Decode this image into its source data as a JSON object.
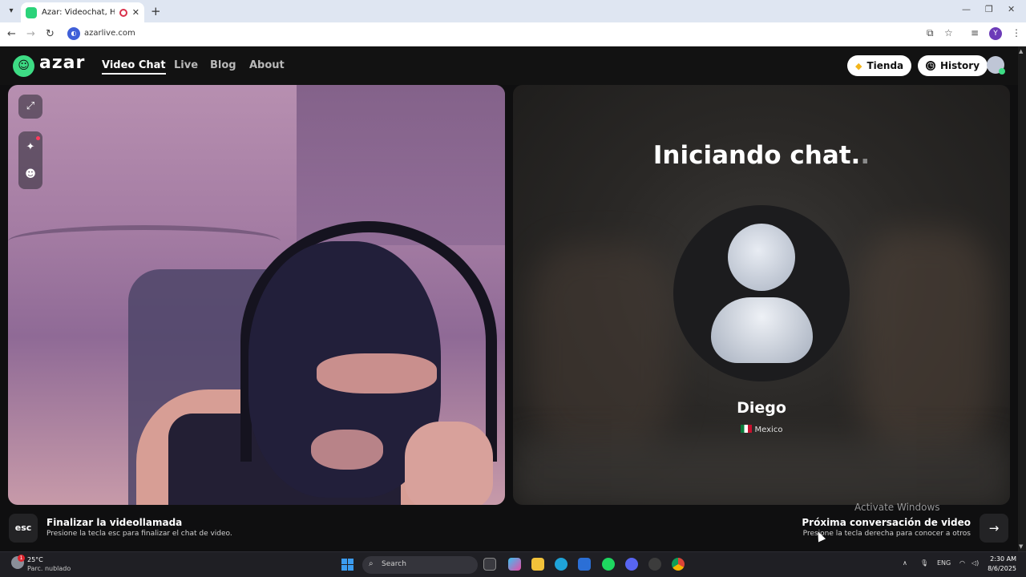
{
  "browser": {
    "tab_title": "Azar: Videochat, Haz nuevo",
    "url": "azarlive.com",
    "profile_initial": "Y"
  },
  "header": {
    "logo": "azar",
    "nav": [
      "Video Chat",
      "Live",
      "Blog",
      "About"
    ],
    "active_nav": "Video Chat",
    "store_label": "Tienda",
    "history_label": "History"
  },
  "left_panel": {
    "tools": [
      "expand-icon",
      "sparkle-effects-icon",
      "face-sticker-icon"
    ]
  },
  "right_panel": {
    "status_text": "Iniciando chat.",
    "status_dots": ".",
    "peer_name": "Diego",
    "peer_country": "Mexico"
  },
  "bottom_bar": {
    "esc_key": "esc",
    "end_title": "Finalizar la videollamada",
    "end_subtitle": "Presione la tecla esc para finalizar el chat de video.",
    "next_title": "Próxima conversación de video",
    "next_subtitle": "Presione la tecla derecha para conocer a otros",
    "watermark": "Activate Windows"
  },
  "taskbar": {
    "weather_badge": "1",
    "temperature": "25°C",
    "condition": "Parc. nublado",
    "search_placeholder": "Search",
    "language": "ENG",
    "time": "2:30 AM",
    "date": "8/6/2025"
  },
  "colors": {
    "brand_green": "#3ddc84",
    "recording_red": "#d9304a",
    "header_bg": "#121212"
  }
}
